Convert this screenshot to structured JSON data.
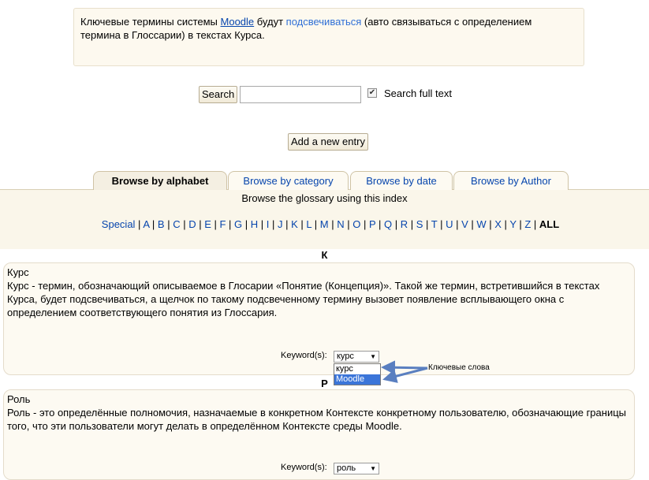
{
  "intro": {
    "text_before": "Ключевые термины системы ",
    "moodle_link": "Moodle",
    "text_mid": " будут ",
    "highlight_link": "подсвечиваться",
    "text_after": " (авто связываться с определением термина в Глоссарии) в текстах Курса."
  },
  "search": {
    "button_label": "Search",
    "input_value": "",
    "fulltext_checked": true,
    "fulltext_label": "Search full text"
  },
  "add_entry_label": "Add a new entry",
  "tabs": [
    {
      "label": "Browse by alphabet",
      "active": true
    },
    {
      "label": "Browse by category",
      "active": false
    },
    {
      "label": "Browse by date",
      "active": false
    },
    {
      "label": "Browse by Author",
      "active": false
    }
  ],
  "browse_caption": "Browse the glossary using this index",
  "alphabet": [
    "Special",
    "A",
    "B",
    "C",
    "D",
    "E",
    "F",
    "G",
    "H",
    "I",
    "J",
    "K",
    "L",
    "M",
    "N",
    "O",
    "P",
    "Q",
    "R",
    "S",
    "T",
    "U",
    "V",
    "W",
    "X",
    "Y",
    "Z"
  ],
  "alphabet_all": "ALL",
  "entries": [
    {
      "letter": "К",
      "title": "Курс",
      "definition": "Курс - термин, обозначающий описываемое в Глосарии «Понятие (Концепция)». Такой же термин, встретившийся в текстах Курса, будет подсвечиваться, а щелчок по такому подсвеченному термину вызовет появление всплывающего окна с определением соответствующего понятия из Глоссария.",
      "keyword_label": "Keyword(s):",
      "keyword_selected": "курс"
    },
    {
      "letter": "Р",
      "title": "Роль",
      "definition": "Роль - это определённые полномочия, назначаемые в конкретном Контексте конкретному пользователю, обозначающие границы того, что эти пользователи могут делать в определённом Контексте среды Moodle.",
      "keyword_label": "Keyword(s):",
      "keyword_selected": "роль"
    }
  ],
  "keyword_dropdown_options": [
    "курс",
    "Moodle"
  ],
  "keyword_dropdown_highlighted": "Moodle",
  "annotation_label": "Ключевые слова",
  "colors": {
    "link": "#0645ad",
    "panel": "#faf6ea",
    "highlight": "#3b75d9",
    "arrow": "#5a7fc0"
  }
}
